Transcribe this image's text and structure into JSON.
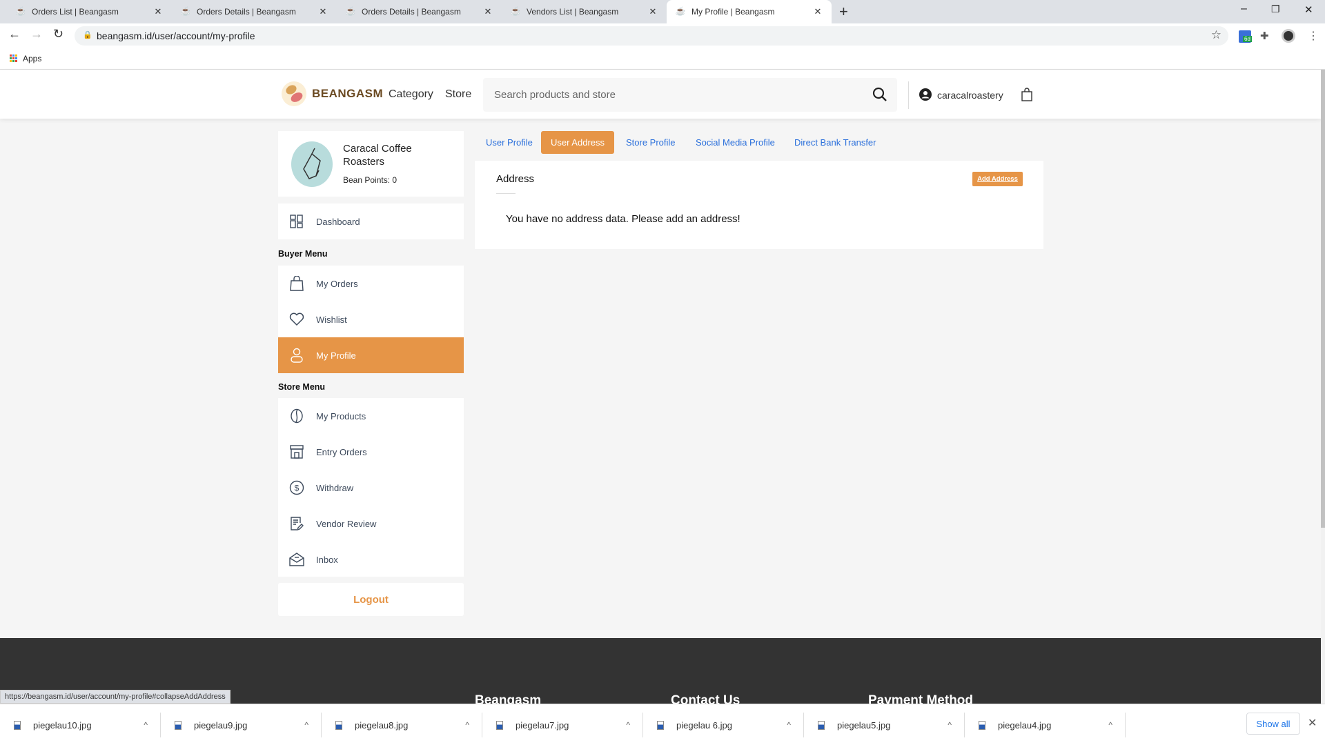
{
  "browser": {
    "tabs": [
      {
        "title": "Orders List | Beangasm",
        "active": false
      },
      {
        "title": "Orders Details | Beangasm",
        "active": false
      },
      {
        "title": "Orders Details | Beangasm",
        "active": false
      },
      {
        "title": "Vendors List | Beangasm",
        "active": false
      },
      {
        "title": "My Profile | Beangasm",
        "active": true
      }
    ],
    "url": "beangasm.id/user/account/my-profile",
    "bookmarks_apps": "Apps",
    "extension_badge": "6d",
    "status_url": "https://beangasm.id/user/account/my-profile#collapseAddAddress"
  },
  "header": {
    "logo": "BEANGASM",
    "nav": [
      "Category",
      "Store"
    ],
    "search_placeholder": "Search products and store",
    "username": "caracalroastery"
  },
  "profile": {
    "name": "Caracal Coffee Roasters",
    "bean_points": "Bean Points: 0"
  },
  "sidebar": {
    "dashboard": "Dashboard",
    "buyer_title": "Buyer Menu",
    "buyer_items": [
      {
        "label": "My Orders",
        "icon": "shopping-bag-icon"
      },
      {
        "label": "Wishlist",
        "icon": "heart-icon"
      },
      {
        "label": "My Profile",
        "icon": "user-icon",
        "active": true
      }
    ],
    "store_title": "Store Menu",
    "store_items": [
      {
        "label": "My Products",
        "icon": "coffee-bean-icon"
      },
      {
        "label": "Entry Orders",
        "icon": "store-icon"
      },
      {
        "label": "Withdraw",
        "icon": "dollar-circle-icon"
      },
      {
        "label": "Vendor Review",
        "icon": "review-edit-icon"
      },
      {
        "label": "Inbox",
        "icon": "open-mail-icon"
      }
    ],
    "logout": "Logout"
  },
  "profile_tabs": [
    "User Profile",
    "User Address",
    "Store Profile",
    "Social Media Profile",
    "Direct Bank Transfer"
  ],
  "address": {
    "title": "Address",
    "add_button": "Add Address",
    "empty_message": "You have no address data. Please add an address!"
  },
  "footer": {
    "headings": [
      "Beangasm",
      "Contact Us",
      "Payment Method"
    ]
  },
  "downloads": {
    "files": [
      "piegelau10.jpg",
      "piegelau9.jpg",
      "piegelau8.jpg",
      "piegelau7.jpg",
      "piegelau 6.jpg",
      "piegelau5.jpg",
      "piegelau4.jpg"
    ],
    "show_all": "Show all"
  },
  "colors": {
    "accent": "#e69547",
    "link": "#2a6fdb",
    "footer": "#333333"
  }
}
